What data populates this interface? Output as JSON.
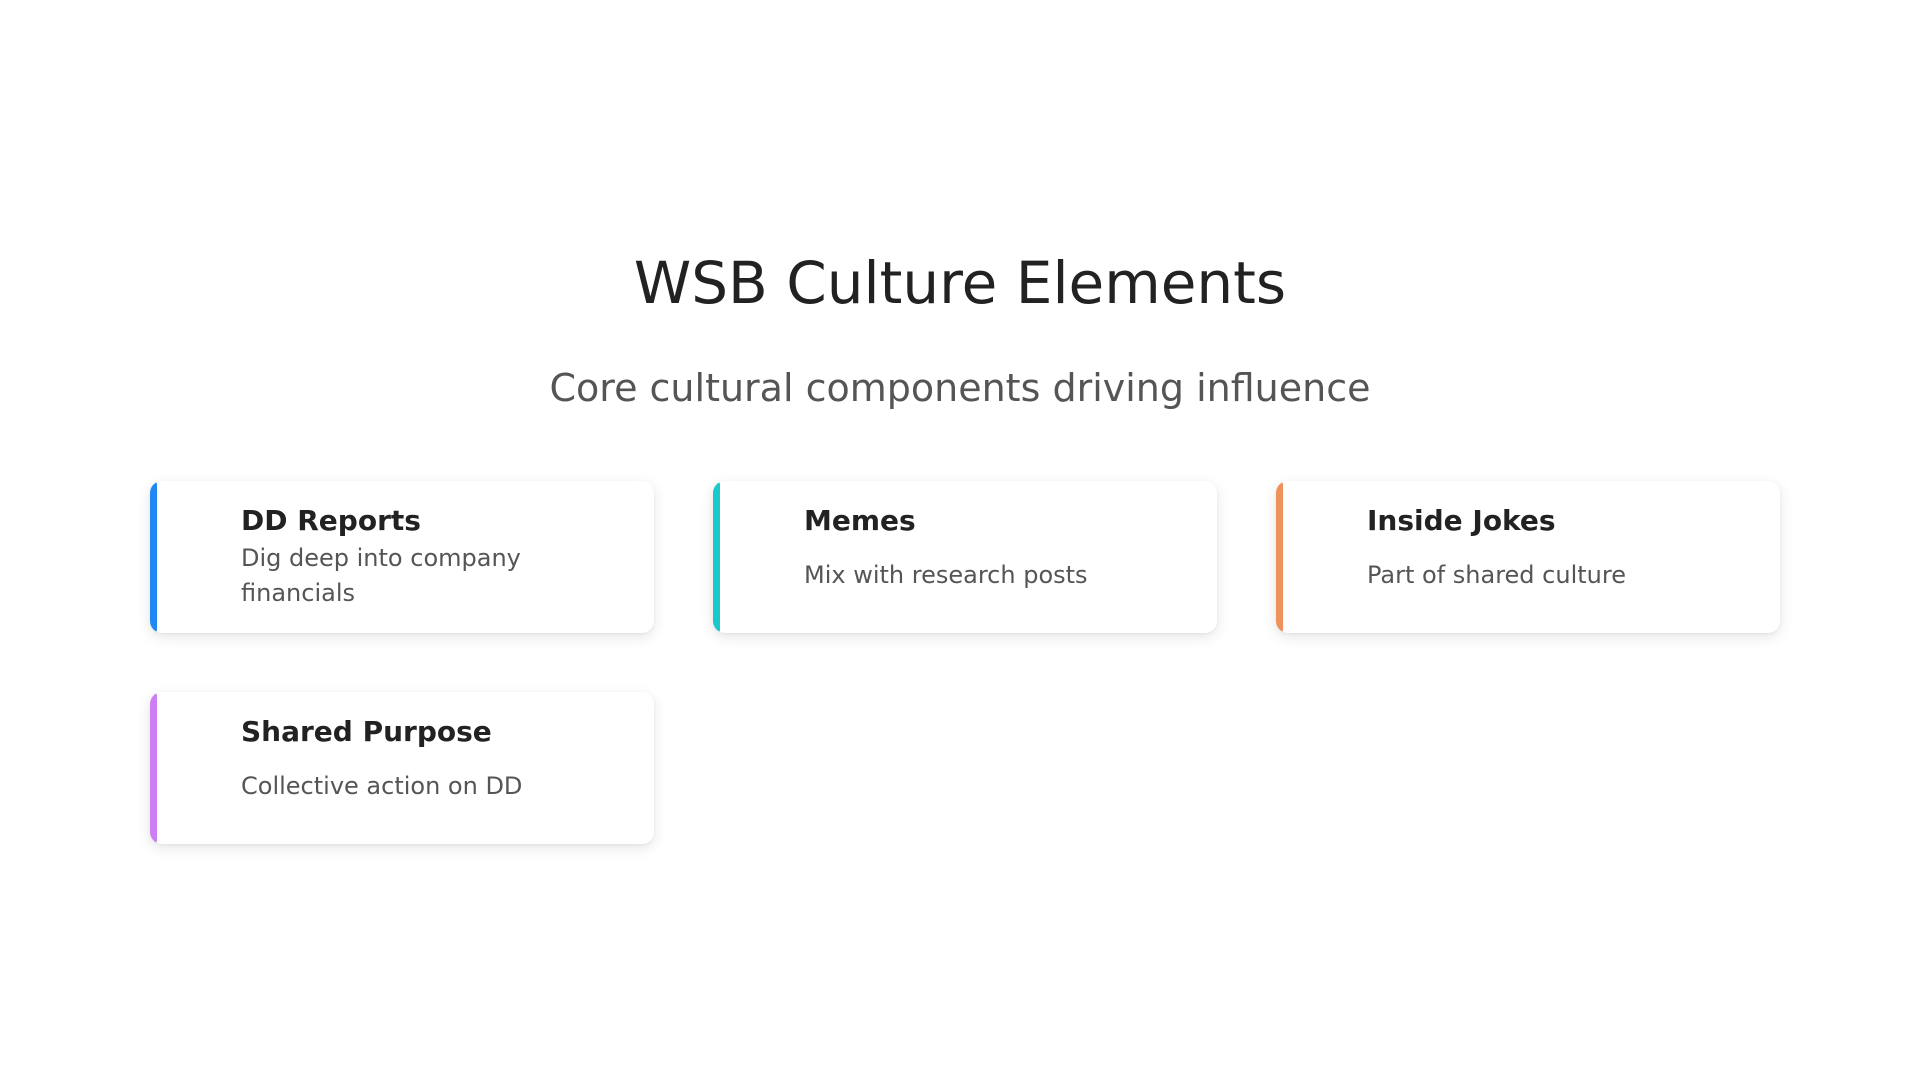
{
  "title": "WSB Culture Elements",
  "subtitle": "Core cultural components driving influence",
  "cards": [
    {
      "title": "DD Reports",
      "description": "Dig deep into company financials",
      "accent": "#1e88f5"
    },
    {
      "title": "Memes",
      "description": "Mix with research posts",
      "accent": "#1cc8c8"
    },
    {
      "title": "Inside Jokes",
      "description": "Part of shared culture",
      "accent": "#f0905a"
    },
    {
      "title": "Shared Purpose",
      "description": "Collective action on DD",
      "accent": "#cf7df2"
    }
  ]
}
